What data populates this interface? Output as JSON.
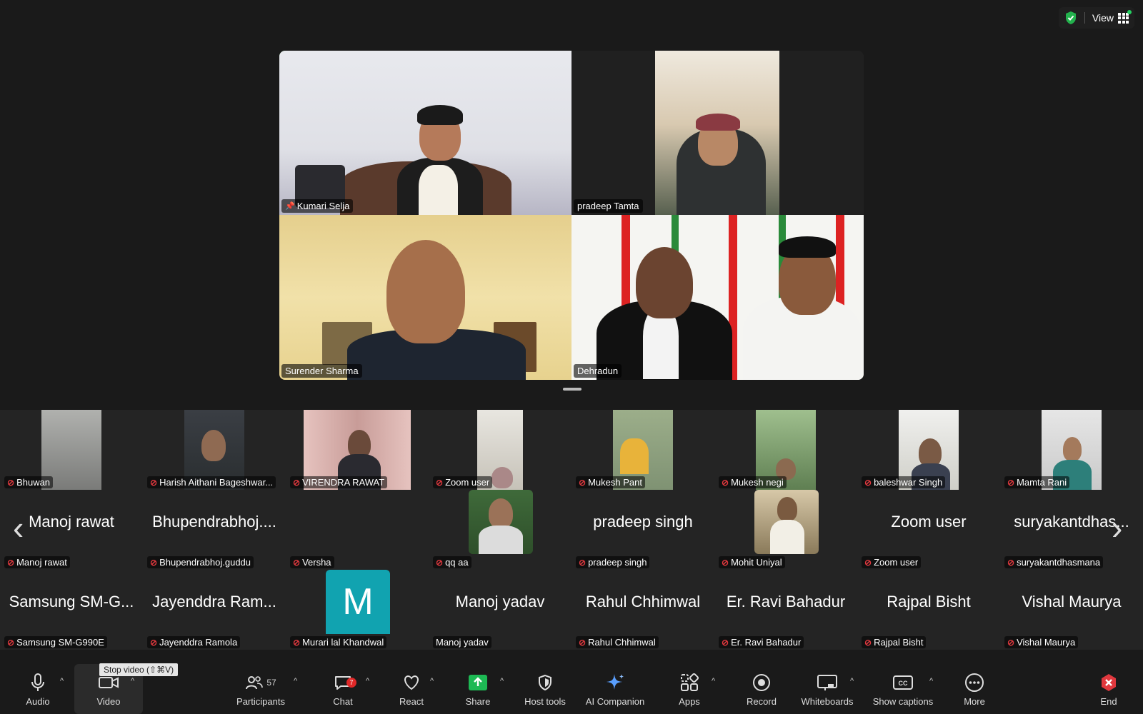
{
  "topbar": {
    "view_label": "View"
  },
  "main_tiles": [
    {
      "name": "Kumari Selja",
      "active": true
    },
    {
      "name": "pradeep Tamta"
    },
    {
      "name": "Surender Sharma"
    },
    {
      "name": "Dehradun"
    }
  ],
  "gallery": {
    "row1": [
      {
        "label": "Bhuwan"
      },
      {
        "label": "Harish Aithani Bageshwar..."
      },
      {
        "label": "VIRENDRA RAWAT"
      },
      {
        "label": "Zoom user"
      },
      {
        "label": "Mukesh Pant"
      },
      {
        "label": "Mukesh negi"
      },
      {
        "label": "baleshwar Singh"
      },
      {
        "label": "Mamta Rani"
      }
    ],
    "row2": [
      {
        "big": "Manoj rawat",
        "label": "Manoj rawat"
      },
      {
        "big": "Bhupendrabhoj....",
        "label": "Bhupendrabhoj.guddu"
      },
      {
        "big": "",
        "label": "Versha"
      },
      {
        "big": "",
        "label": "qq aa"
      },
      {
        "big": "pradeep singh",
        "label": "pradeep singh"
      },
      {
        "big": "",
        "label": "Mohit Uniyal"
      },
      {
        "big": "Zoom user",
        "label": "Zoom user"
      },
      {
        "big": "suryakantdhas...",
        "label": "suryakantdhasmana"
      }
    ],
    "row3": [
      {
        "big": "Samsung SM-G...",
        "label": "Samsung SM-G990E"
      },
      {
        "big": "Jayenddra Ram...",
        "label": "Jayenddra Ramola"
      },
      {
        "big": "",
        "avatar": "M",
        "label": "Murari lal Khandwal"
      },
      {
        "big": "Manoj yadav",
        "label": "Manoj yadav"
      },
      {
        "big": "Rahul Chhimwal",
        "label": "Rahul Chhimwal"
      },
      {
        "big": "Er. Ravi Bahadur",
        "label": "Er. Ravi Bahadur"
      },
      {
        "big": "Rajpal Bisht",
        "label": "Rajpal Bisht"
      },
      {
        "big": "Vishal Maurya",
        "label": "Vishal Maurya"
      }
    ]
  },
  "toolbar": {
    "audio": "Audio",
    "video": "Video",
    "video_tooltip": "Stop video (⇧⌘V)",
    "participants": "Participants",
    "participants_count": "57",
    "chat": "Chat",
    "chat_badge": "7",
    "react": "React",
    "share": "Share",
    "host_tools": "Host tools",
    "ai_companion": "AI Companion",
    "apps": "Apps",
    "record": "Record",
    "whiteboards": "Whiteboards",
    "show_captions": "Show captions",
    "more": "More",
    "end": "End"
  },
  "colors": {
    "active_border": "#2bbb45",
    "share_green": "#1db954",
    "end_red": "#e0383e",
    "muted_red": "#e0383e",
    "avatar_teal": "#11a3b0"
  }
}
